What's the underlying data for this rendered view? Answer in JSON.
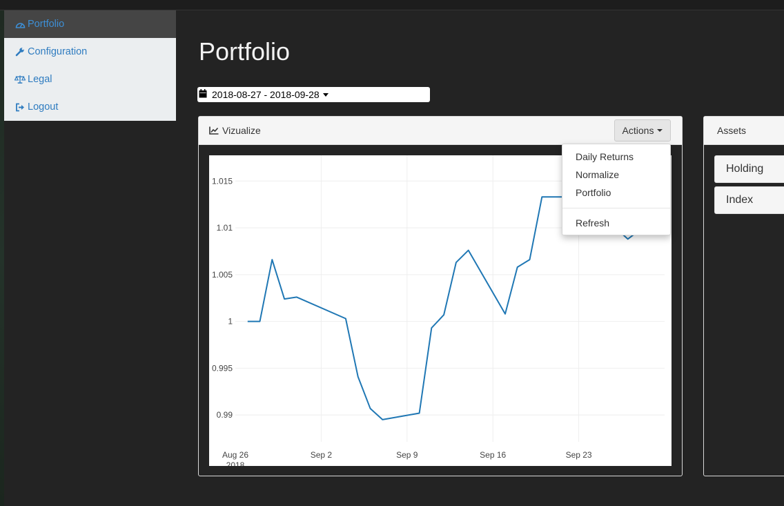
{
  "sidebar": {
    "items": [
      {
        "label": "Portfolio",
        "icon": "dashboard-icon",
        "active": true
      },
      {
        "label": "Configuration",
        "icon": "wrench-icon",
        "active": false
      },
      {
        "label": "Legal",
        "icon": "balance-scale-icon",
        "active": false
      },
      {
        "label": "Logout",
        "icon": "sign-out-icon",
        "active": false
      }
    ]
  },
  "page": {
    "title": "Portfolio"
  },
  "daterange": {
    "value": "2018-08-27 - 2018-09-28",
    "icon": "calendar-icon"
  },
  "panel": {
    "title": "Vizualize",
    "icon": "line-chart-icon",
    "actions_label": "Actions"
  },
  "actions_menu": {
    "items": [
      "Daily Returns",
      "Normalize",
      "Portfolio"
    ],
    "extra": [
      "Refresh"
    ]
  },
  "assets": {
    "title": "Assets",
    "items": [
      "Holding",
      "Index"
    ]
  },
  "colors": {
    "line": "#1f77b4",
    "link": "#2f7cc0",
    "background": "#232323"
  },
  "chart_data": {
    "type": "line",
    "x": [
      "2018-08-27",
      "2018-08-28",
      "2018-08-29",
      "2018-08-30",
      "2018-08-31",
      "2018-09-04",
      "2018-09-05",
      "2018-09-06",
      "2018-09-07",
      "2018-09-10",
      "2018-09-11",
      "2018-09-12",
      "2018-09-13",
      "2018-09-14",
      "2018-09-17",
      "2018-09-18",
      "2018-09-19",
      "2018-09-20",
      "2018-09-21",
      "2018-09-24",
      "2018-09-25",
      "2018-09-26",
      "2018-09-27",
      "2018-09-28"
    ],
    "series": [
      {
        "values": [
          1.0,
          1.0,
          1.0066,
          1.0024,
          1.0026,
          1.0003,
          0.9941,
          0.9907,
          0.9895,
          0.9902,
          0.9993,
          1.0007,
          1.0063,
          1.0076,
          1.0008,
          1.0058,
          1.0066,
          1.0133,
          1.0133,
          1.0133,
          1.012,
          1.01,
          1.0088,
          1.0098
        ]
      }
    ],
    "yticks": [
      "0.99",
      "0.995",
      "1",
      "1.005",
      "1.01",
      "1.015"
    ],
    "xticks": [
      {
        "label": "Aug 26",
        "date": "2018-08-26"
      },
      {
        "label": "Sep 2",
        "date": "2018-09-02"
      },
      {
        "label": "Sep 9",
        "date": "2018-09-09"
      },
      {
        "label": "Sep 16",
        "date": "2018-09-16"
      },
      {
        "label": "Sep 23",
        "date": "2018-09-23"
      }
    ],
    "year_label": "2018",
    "xlim": [
      "2018-08-26",
      "2018-09-30"
    ],
    "ylim": [
      0.9885,
      1.0155
    ],
    "grid": true
  }
}
